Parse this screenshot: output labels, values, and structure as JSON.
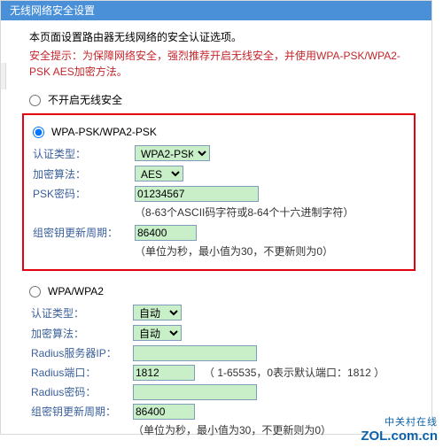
{
  "header": {
    "title": "无线网络安全设置"
  },
  "intro": "本页面设置路由器无线网络的安全认证选项。",
  "warning": "安全提示：为保障网络安全，强烈推荐开启无线安全，并使用WPA-PSK/WPA2-PSK AES加密方法。",
  "radios": {
    "disable_label": "不开启无线安全",
    "wpa_psk_label": "WPA-PSK/WPA2-PSK",
    "wpa_label": "WPA/WPA2"
  },
  "labels": {
    "auth_type": "认证类型：",
    "encrypt_algo": "加密算法：",
    "psk_pwd": "PSK密码：",
    "group_rekey": "组密钥更新周期：",
    "radius_ip": "Radius服务器IP：",
    "radius_port": "Radius端口：",
    "radius_pwd": "Radius密码："
  },
  "section_psk": {
    "auth_type_value": "WPA2-PSK",
    "encrypt_algo_value": "AES",
    "psk_pwd_value": "01234567",
    "psk_pwd_note": "（8-63个ASCII码字符或8-64个十六进制字符）",
    "group_rekey_value": "86400",
    "group_rekey_note": "（单位为秒，最小值为30，不更新则为0）"
  },
  "section_wpa": {
    "auth_type_value": "自动",
    "encrypt_algo_value": "自动",
    "radius_ip_value": "",
    "radius_port_value": "1812",
    "radius_port_note": "（ 1-65535，0表示默认端口：1812 ）",
    "radius_pwd_value": "",
    "group_rekey_value": "86400",
    "group_rekey_note": "（单位为秒，最小值为30，不更新则为0）"
  },
  "watermark": {
    "cn": "中关村在线",
    "en": "ZOL.com.cn"
  }
}
